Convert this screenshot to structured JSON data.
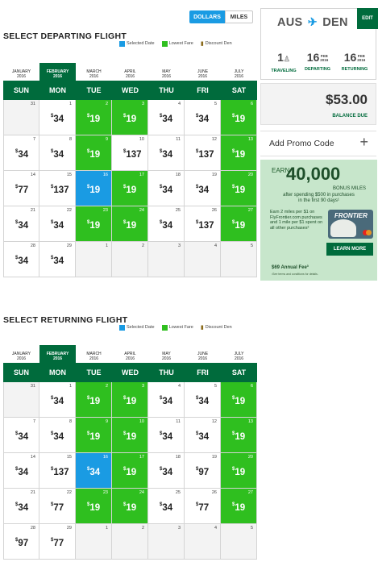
{
  "units": {
    "dollars": "DOLLARS",
    "miles": "MILES"
  },
  "departing": {
    "title": "SELECT DEPARTING FLIGHT",
    "legend": {
      "selected": "Selected Date",
      "lowest": "Lowest Fare",
      "discount": "Discount Den"
    },
    "months": [
      {
        "name": "JANUARY",
        "year": "2016"
      },
      {
        "name": "FEBRUARY",
        "year": "2016",
        "active": true
      },
      {
        "name": "MARCH",
        "year": "2016"
      },
      {
        "name": "APRIL",
        "year": "2016"
      },
      {
        "name": "MAY",
        "year": "2016"
      },
      {
        "name": "JUNE",
        "year": "2016"
      },
      {
        "name": "JULY",
        "year": "2016"
      }
    ],
    "weekdays": [
      "SUN",
      "MON",
      "TUE",
      "WED",
      "THU",
      "FRI",
      "SAT"
    ],
    "days": [
      {
        "d": "31",
        "t": "empty"
      },
      {
        "d": "1",
        "p": "34"
      },
      {
        "d": "2",
        "p": "19",
        "t": "low"
      },
      {
        "d": "3",
        "p": "19",
        "t": "low"
      },
      {
        "d": "4",
        "p": "34"
      },
      {
        "d": "5",
        "p": "34"
      },
      {
        "d": "6",
        "p": "19",
        "t": "low"
      },
      {
        "d": "7",
        "p": "34"
      },
      {
        "d": "8",
        "p": "34"
      },
      {
        "d": "9",
        "p": "19",
        "t": "low"
      },
      {
        "d": "10",
        "p": "137"
      },
      {
        "d": "11",
        "p": "34"
      },
      {
        "d": "12",
        "p": "137"
      },
      {
        "d": "13",
        "p": "19",
        "t": "low"
      },
      {
        "d": "14",
        "p": "77"
      },
      {
        "d": "15",
        "p": "137"
      },
      {
        "d": "16",
        "p": "19",
        "t": "sel"
      },
      {
        "d": "17",
        "p": "19",
        "t": "low"
      },
      {
        "d": "18",
        "p": "34"
      },
      {
        "d": "19",
        "p": "34"
      },
      {
        "d": "20",
        "p": "19",
        "t": "low"
      },
      {
        "d": "21",
        "p": "34"
      },
      {
        "d": "22",
        "p": "34"
      },
      {
        "d": "23",
        "p": "19",
        "t": "low"
      },
      {
        "d": "24",
        "p": "19",
        "t": "low"
      },
      {
        "d": "25",
        "p": "34"
      },
      {
        "d": "26",
        "p": "137"
      },
      {
        "d": "27",
        "p": "19",
        "t": "low"
      },
      {
        "d": "28",
        "p": "34"
      },
      {
        "d": "29",
        "p": "34"
      },
      {
        "d": "1",
        "t": "future"
      },
      {
        "d": "2",
        "t": "future"
      },
      {
        "d": "3",
        "t": "future"
      },
      {
        "d": "4",
        "t": "future"
      },
      {
        "d": "5",
        "t": "future"
      }
    ]
  },
  "returning": {
    "title": "SELECT RETURNING FLIGHT",
    "legend": {
      "selected": "Selected Date",
      "lowest": "Lowest Fare",
      "discount": "Discount Den"
    },
    "months": [
      {
        "name": "JANUARY",
        "year": "2016"
      },
      {
        "name": "FEBRUARY",
        "year": "2016",
        "active": true
      },
      {
        "name": "MARCH",
        "year": "2016"
      },
      {
        "name": "APRIL",
        "year": "2016"
      },
      {
        "name": "MAY",
        "year": "2016"
      },
      {
        "name": "JUNE",
        "year": "2016"
      },
      {
        "name": "JULY",
        "year": "2016"
      }
    ],
    "weekdays": [
      "SUN",
      "MON",
      "TUE",
      "WED",
      "THU",
      "FRI",
      "SAT"
    ],
    "days": [
      {
        "d": "31",
        "t": "empty"
      },
      {
        "d": "1",
        "p": "34"
      },
      {
        "d": "2",
        "p": "19",
        "t": "low"
      },
      {
        "d": "3",
        "p": "19",
        "t": "low"
      },
      {
        "d": "4",
        "p": "34"
      },
      {
        "d": "5",
        "p": "34"
      },
      {
        "d": "6",
        "p": "19",
        "t": "low"
      },
      {
        "d": "7",
        "p": "34"
      },
      {
        "d": "8",
        "p": "34"
      },
      {
        "d": "9",
        "p": "19",
        "t": "low"
      },
      {
        "d": "10",
        "p": "19",
        "t": "low"
      },
      {
        "d": "11",
        "p": "34"
      },
      {
        "d": "12",
        "p": "34"
      },
      {
        "d": "13",
        "p": "19",
        "t": "low"
      },
      {
        "d": "14",
        "p": "34"
      },
      {
        "d": "15",
        "p": "137"
      },
      {
        "d": "16",
        "p": "34",
        "t": "sel"
      },
      {
        "d": "17",
        "p": "19",
        "t": "low"
      },
      {
        "d": "18",
        "p": "34"
      },
      {
        "d": "19",
        "p": "97"
      },
      {
        "d": "20",
        "p": "19",
        "t": "low"
      },
      {
        "d": "21",
        "p": "34"
      },
      {
        "d": "22",
        "p": "77"
      },
      {
        "d": "23",
        "p": "19",
        "t": "low"
      },
      {
        "d": "24",
        "p": "19",
        "t": "low"
      },
      {
        "d": "25",
        "p": "34"
      },
      {
        "d": "26",
        "p": "77"
      },
      {
        "d": "27",
        "p": "19",
        "t": "low"
      },
      {
        "d": "28",
        "p": "97"
      },
      {
        "d": "29",
        "p": "77"
      },
      {
        "d": "1",
        "t": "future"
      },
      {
        "d": "2",
        "t": "future"
      },
      {
        "d": "3",
        "t": "future"
      },
      {
        "d": "4",
        "t": "future"
      },
      {
        "d": "5",
        "t": "future"
      }
    ]
  },
  "trip": {
    "origin": "AUS",
    "destination": "DEN",
    "plane_icon": "plane-icon",
    "edit": "EDIT",
    "travelers": {
      "value": "1",
      "label": "TRAVELING",
      "icon": "person-icon"
    },
    "departing": {
      "day": "16",
      "month": "FEB",
      "year": "2016",
      "label": "DEPARTING"
    },
    "returning": {
      "day": "16",
      "month": "FEB",
      "year": "2016",
      "label": "RETURNING"
    }
  },
  "balance": {
    "amount": "$53.00",
    "label": "BALANCE DUE"
  },
  "promo": {
    "label": "Add Promo Code",
    "plus": "+"
  },
  "ad": {
    "earn": "EARN",
    "big": "40,000",
    "bonus": "BONUS MILES",
    "after1": "after spending $500 in purchases",
    "after2": "in the first 90 days¹",
    "earn2": "Earn 2 miles per $1 on FlyFrontier.com purchases and 1 mile per $1 spent on all other purchases²",
    "card_brand": "FRONTIER",
    "learn_more": "LEARN MORE",
    "fee": "$69 Annual Fee³",
    "terms": "¹See terms and conditions for details."
  },
  "colors": {
    "brand_green": "#006b3c",
    "lowest_fare": "#2fbf1f",
    "selected": "#1a9be3"
  }
}
